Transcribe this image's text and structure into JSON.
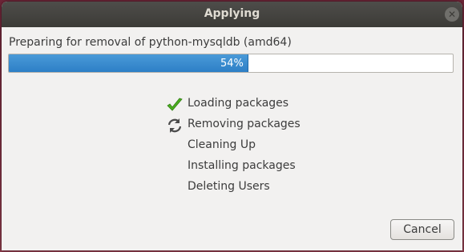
{
  "window": {
    "title": "Applying"
  },
  "status": {
    "message": "Preparing for removal of python-mysqldb (amd64)"
  },
  "progress": {
    "percent": 54,
    "label": "54%",
    "fill_color": "#3b8bd0"
  },
  "steps": [
    {
      "label": "Loading packages",
      "state": "done",
      "icon": "checkmark-icon"
    },
    {
      "label": "Removing packages",
      "state": "in-progress",
      "icon": "refresh-icon"
    },
    {
      "label": "Cleaning Up",
      "state": "pending",
      "icon": ""
    },
    {
      "label": "Installing packages",
      "state": "pending",
      "icon": ""
    },
    {
      "label": "Deleting Users",
      "state": "pending",
      "icon": ""
    }
  ],
  "buttons": {
    "cancel_label": "Cancel"
  }
}
